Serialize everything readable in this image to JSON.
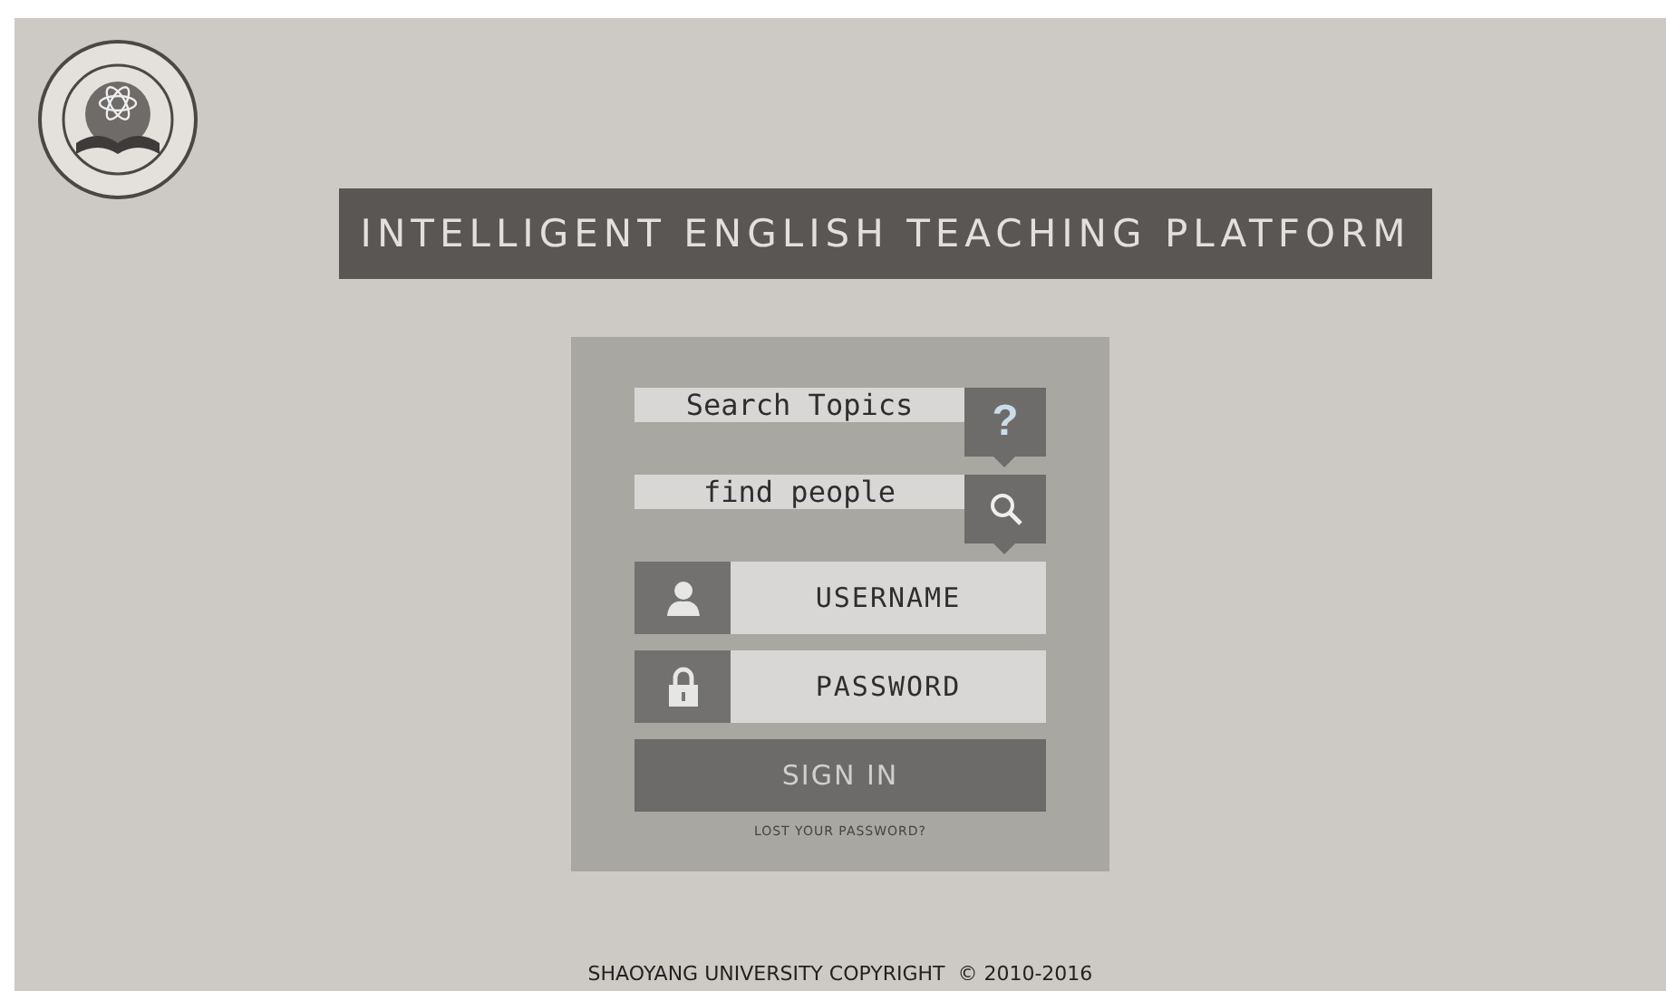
{
  "banner": {
    "title": "INTELLIGENT ENGLISH TEACHING PLATFORM"
  },
  "login": {
    "search_fields": [
      {
        "placeholder": "Search Topics",
        "kind": "help",
        "icon": "?"
      },
      {
        "placeholder": "find people",
        "kind": "search"
      }
    ],
    "credential_fields": [
      {
        "placeholder": "USERNAME",
        "kind": "user"
      },
      {
        "placeholder": "PASSWORD",
        "kind": "password"
      }
    ],
    "submit": "SIGN IN",
    "lost_password": "LOST YOUR PASSWORD?"
  },
  "footer": "SHAOYANG UNIVERSITY COPYRIGHT  © 2010-2016"
}
